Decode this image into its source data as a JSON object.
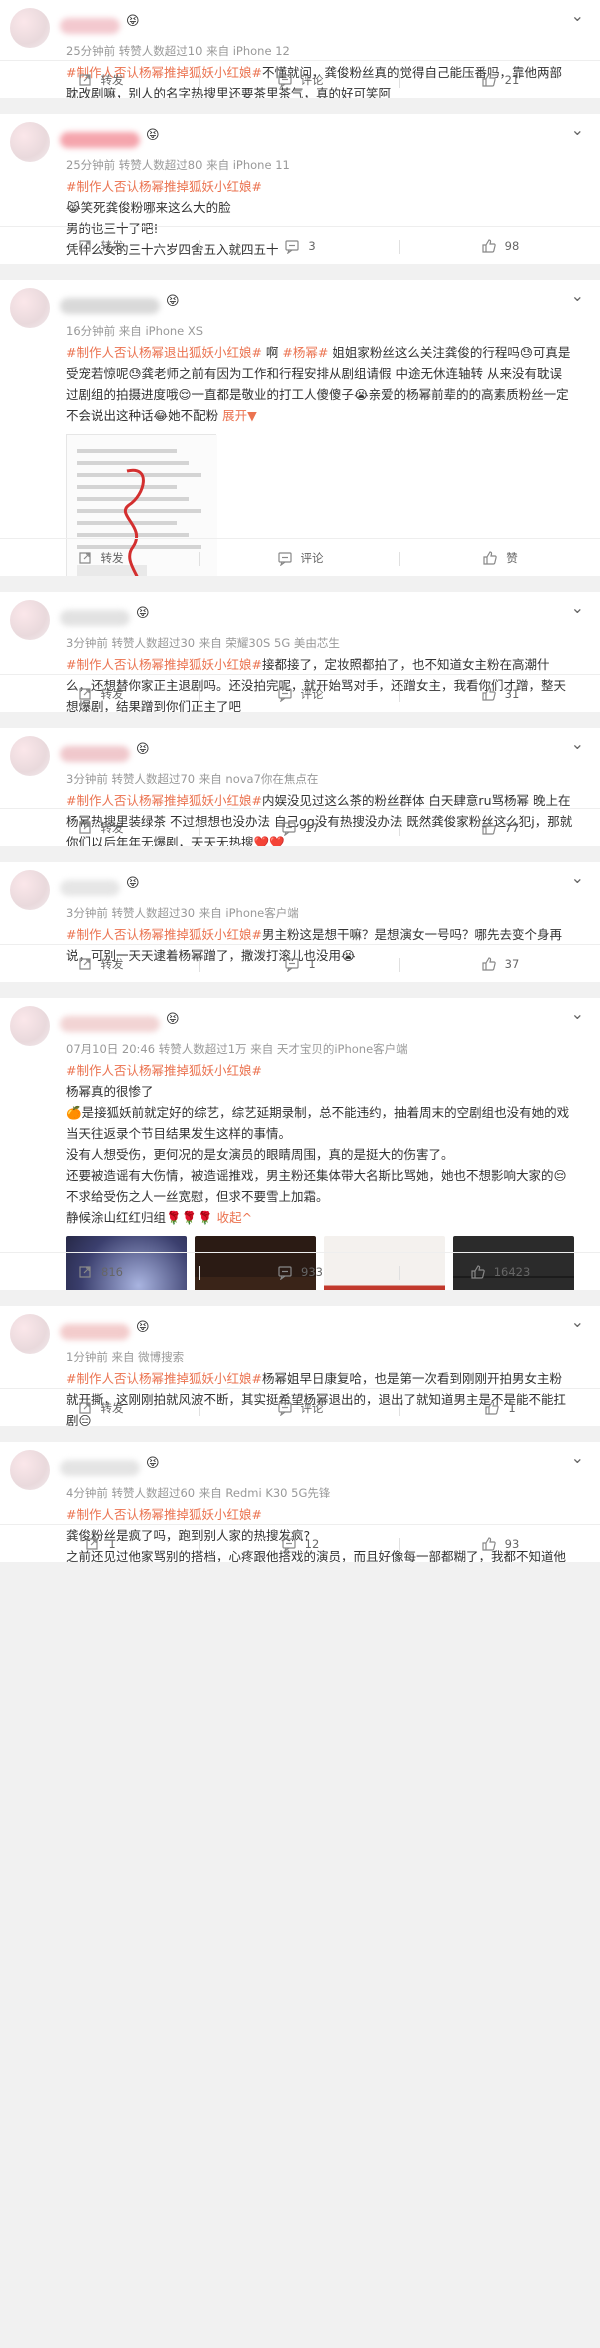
{
  "posts": [
    {
      "meta": "25分钟前 转赞人数超过10 来自 iPhone 12",
      "content": [
        {
          "t": "topic",
          "v": "#制作人否认杨幂推掉狐妖小红娘#"
        },
        {
          "t": "text",
          "v": "不懂就问，龚俊粉丝真的觉得自己能压番吗，靠他两部耽改剧嘛，别人的名字热搜里还要茶里茶气，真的好可笑阿"
        }
      ],
      "repost": "转发",
      "comment": "评论",
      "like": "21"
    },
    {
      "meta": "25分钟前 转赞人数超过80 来自 iPhone 11",
      "content": [
        {
          "t": "topic",
          "v": "#制作人否认杨幂推掉狐妖小红娘#"
        },
        {
          "t": "text",
          "v": "\n😹笑死龚俊粉哪来这么大的脸\n男的也三十了吧!\n凭什么女的三十六岁四舍五入就四五十\n男的就年轻了"
        }
      ],
      "repost": "转发",
      "comment": "3",
      "like": "98"
    },
    {
      "meta": "16分钟前 来自 iPhone XS",
      "content": [
        {
          "t": "topic",
          "v": "#制作人否认杨幂退出狐妖小红娘#"
        },
        {
          "t": "text",
          "v": " 啊 "
        },
        {
          "t": "topic",
          "v": "#杨幂#"
        },
        {
          "t": "text",
          "v": " 姐姐家粉丝这么关注龚俊的行程吗😓可真是受宠若惊呢😓龚老师之前有因为工作和行程安排从剧组请假 中途无休连轴转 从来没有耽误过剧组的拍摄进度哦😌一直都是敬业的打工人傻傻子😭亲爱的杨幂前辈的的高素质粉丝一定不会说出这种话😂她不配粉 "
        },
        {
          "t": "more",
          "v": "展开▼"
        }
      ],
      "repost": "转发",
      "comment": "评论",
      "like": "赞"
    },
    {
      "meta": "3分钟前 转赞人数超过30 来自 荣耀30S 5G 美由芯生",
      "content": [
        {
          "t": "topic",
          "v": "#制作人否认杨幂推掉狐妖小红娘#"
        },
        {
          "t": "text",
          "v": "接都接了，定妆照都拍了，也不知道女主粉在高潮什么，还想替你家正主退剧吗。还没拍完呢，就开始骂对手，还蹭女主，我看你们才蹭，整天想爆剧，结果蹭到你们正主了吧"
        }
      ],
      "repost": "转发",
      "comment": "评论",
      "like": "31"
    },
    {
      "meta": "3分钟前 转赞人数超过70 来自 nova7你在焦点在",
      "content": [
        {
          "t": "topic",
          "v": "#制作人否认杨幂推掉狐妖小红娘#"
        },
        {
          "t": "text",
          "v": "内娱没见过这么茶的粉丝群体 白天肆意ru骂杨幂 晚上在杨幂热搜里装绿茶 不过想想也没办法 自己gg没有热搜没办法 既然龚俊家粉丝这么犯j，那就你们以后年年无爆剧，天天无热搜❤️❤️"
        }
      ],
      "repost": "转发",
      "comment": "17",
      "like": "77"
    },
    {
      "meta": "3分钟前 转赞人数超过30 来自 iPhone客户端",
      "content": [
        {
          "t": "topic",
          "v": "#制作人否认杨幂推掉狐妖小红娘#"
        },
        {
          "t": "text",
          "v": "男主粉这是想干嘛？是想演女一号吗？哪先去变个身再说，可别一天天逮着杨幂蹭了，撒泼打滚儿也没用😭"
        }
      ],
      "repost": "转发",
      "comment": "1",
      "like": "37"
    },
    {
      "meta": "07月10日 20:46 转赞人数超过1万 来自 天才宝贝的iPhone客户端",
      "content": [
        {
          "t": "topic",
          "v": "#制作人否认杨幂推掉狐妖小红娘#"
        },
        {
          "t": "text",
          "v": "\n杨幂真的很惨了\n🍊是接狐妖前就定好的综艺，综艺延期录制，总不能违约，抽着周末的空剧组也没有她的戏当天往返录个节目结果发生这样的事情。\n没有人想受伤，更何况的是女演员的眼睛周围，真的是挺大的伤害了。\n还要被造谣有大伤情，被造谣推戏，男主粉还集体带大名斯比骂她，她也不想影响大家的😔不求给受伤之人一丝宽慰，但求不要雪上加霜。\n静候涂山红红归组🌹🌹🌹 "
        },
        {
          "t": "fold",
          "v": "收起^"
        }
      ],
      "repost": "816",
      "comment": "933",
      "like": "16423"
    },
    {
      "meta": "1分钟前 来自 微博搜索",
      "content": [
        {
          "t": "topic",
          "v": "#制作人否认杨幂推掉狐妖小红娘#"
        },
        {
          "t": "text",
          "v": "杨幂姐早日康复哈，也是第一次看到刚刚开拍男女主粉就开撕，这刚刚拍就风波不断，其实挺希望杨幂退出的，退出了就知道男主是不是能不能扛剧😑"
        }
      ],
      "repost": "转发",
      "comment": "评论",
      "like": "1"
    },
    {
      "meta": "4分钟前 转赞人数超过60 来自 Redmi K30 5G先锋",
      "content": [
        {
          "t": "topic",
          "v": "#制作人否认杨幂推掉狐妖小红娘#"
        },
        {
          "t": "text",
          "v": "\n龚俊粉丝是疯了吗，跑到别人家的热搜发疯?\n之前还见过他家骂别的搭档，心疼跟他搭戏的演员，而且好像每一部都糊了，我都不知道他火了之后扣了啥😂"
        }
      ],
      "repost": "1",
      "comment": "12",
      "like": "93"
    }
  ],
  "colors": {
    "accent": "#eb7350",
    "meta": "#999999",
    "bg": "#f1f1f1"
  },
  "icons": {
    "repost": "repost-icon",
    "comment": "comment-icon",
    "like": "thumb-up-icon",
    "menu": "chevron-down-icon"
  }
}
